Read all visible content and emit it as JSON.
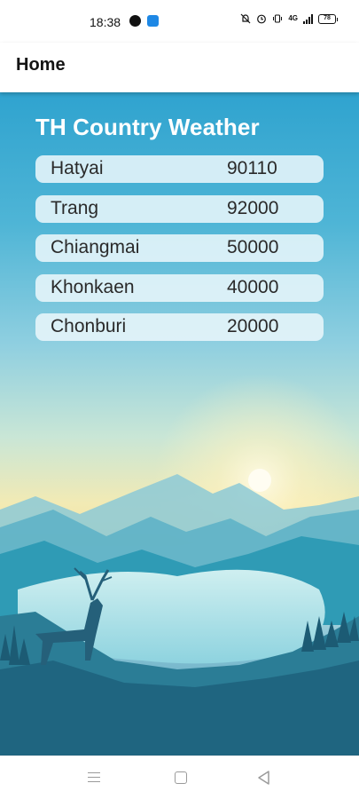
{
  "status_bar": {
    "time": "18:38",
    "battery": "78",
    "network": "4G",
    "icons": [
      "a-icon",
      "cloud-app-icon",
      "mute-icon",
      "alarm-icon",
      "vibrate-icon",
      "signal-icon",
      "battery-icon"
    ]
  },
  "app_bar": {
    "title": "Home"
  },
  "weather": {
    "title": "TH Country Weather",
    "cities": [
      {
        "name": "Hatyai",
        "code": "90110"
      },
      {
        "name": "Trang",
        "code": "92000"
      },
      {
        "name": "Chiangmai",
        "code": "50000"
      },
      {
        "name": "Khonkaen",
        "code": "40000"
      },
      {
        "name": "Chonburi",
        "code": "20000"
      }
    ]
  },
  "nav_bar": {
    "icons": [
      "menu-icon",
      "home-icon",
      "back-icon"
    ]
  }
}
